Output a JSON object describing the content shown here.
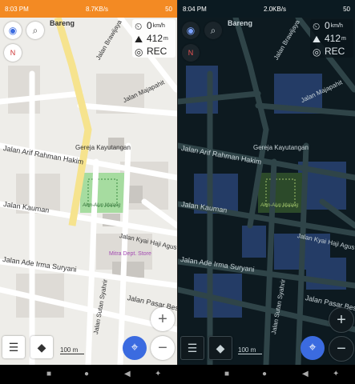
{
  "left": {
    "status": {
      "time": "8:03 PM",
      "speed": "8.7KB/s",
      "battery": "50"
    },
    "town": "Bareng",
    "hud": {
      "speed": "0",
      "speed_unit": "km/h",
      "altitude": "412",
      "alt_unit": "m",
      "rec": "REC"
    },
    "labels": {
      "jalan_majapahit": "Jalan Majapahit",
      "brawijaya": "Jalan Brawijaya",
      "arif_rahman": "Jalan Arif Rahman Hakim",
      "kauman": "Jalan Kauman",
      "kyai_haji": "Jalan Kyai Haji Agus",
      "ade_irma": "Jalan Ade Irma Suryani",
      "pasar_besar": "Jalan Pasar Besar",
      "sutan": "Jalan Sutan Syahrir",
      "gereja": "Gereja Kayutangan",
      "alun": "Alun-Alun Malang",
      "mitra": "Mitra Dept. Store"
    },
    "scale": "100 m",
    "compass": "N"
  },
  "right": {
    "status": {
      "time": "8:04 PM",
      "speed": "2.0KB/s",
      "battery": "50"
    },
    "town": "Bareng",
    "hud": {
      "speed": "0",
      "speed_unit": "km/h",
      "altitude": "412",
      "alt_unit": "m",
      "rec": "REC"
    },
    "labels": {
      "jalan_majapahit": "Jalan Majapahit",
      "brawijaya": "Jalan Brawijaya",
      "arif_rahman": "Jalan Arif Rahman Hakim",
      "kauman": "Jalan Kauman",
      "kyai_haji": "Jalan Kyai Haji Agus",
      "ade_irma": "Jalan Ade Irma Suryani",
      "pasar_besar": "Jalan Pasar Besar",
      "sutan": "Jalan Sutan Syahrir",
      "gereja": "Gereja Kayutangan",
      "alun": "Alun-Alun Malang"
    },
    "scale": "100 m",
    "compass": "N"
  },
  "colors": {
    "accent": "#3b6be0",
    "status_light": "#f38a23",
    "status_dark": "#0b1a21"
  }
}
